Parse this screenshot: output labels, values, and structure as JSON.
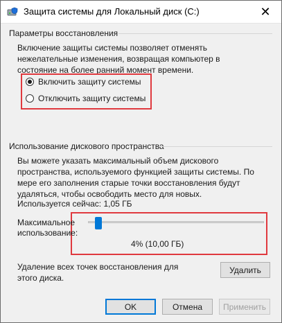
{
  "window": {
    "title": "Защита системы для Локальный диск (C:)",
    "close_glyph": "✕"
  },
  "restore": {
    "section_title": "Параметры восстановления",
    "description": "Включение защиты системы позволяет отменять нежелательные изменения, возвращая компьютер в состояние на более ранний момент времени.",
    "options": [
      {
        "label": "Включить защиту системы",
        "checked": true
      },
      {
        "label": "Отключить защиту системы",
        "checked": false
      }
    ]
  },
  "disk": {
    "section_title": "Использование дискового пространства",
    "description": "Вы можете указать максимальный объем дискового пространства, используемого функцией защиты системы. По мере его заполнения старые точки восстановления будут удаляться, чтобы освободить место для новых.",
    "current_usage": "Используется сейчас: 1,05 ГБ",
    "max_label_line1": "Максимальное",
    "max_label_line2": "использование:",
    "slider_percent": 4,
    "slider_value_text": "4% (10,00 ГБ)",
    "delete_text": "Удаление всех точек восстановления для этого диска.",
    "delete_button": "Удалить"
  },
  "footer": {
    "ok": "OK",
    "cancel": "Отмена",
    "apply": "Применить"
  },
  "colors": {
    "highlight": "#e0393e",
    "accent": "#0078d7"
  },
  "icons": [
    "drive-shield-icon",
    "close-icon"
  ]
}
